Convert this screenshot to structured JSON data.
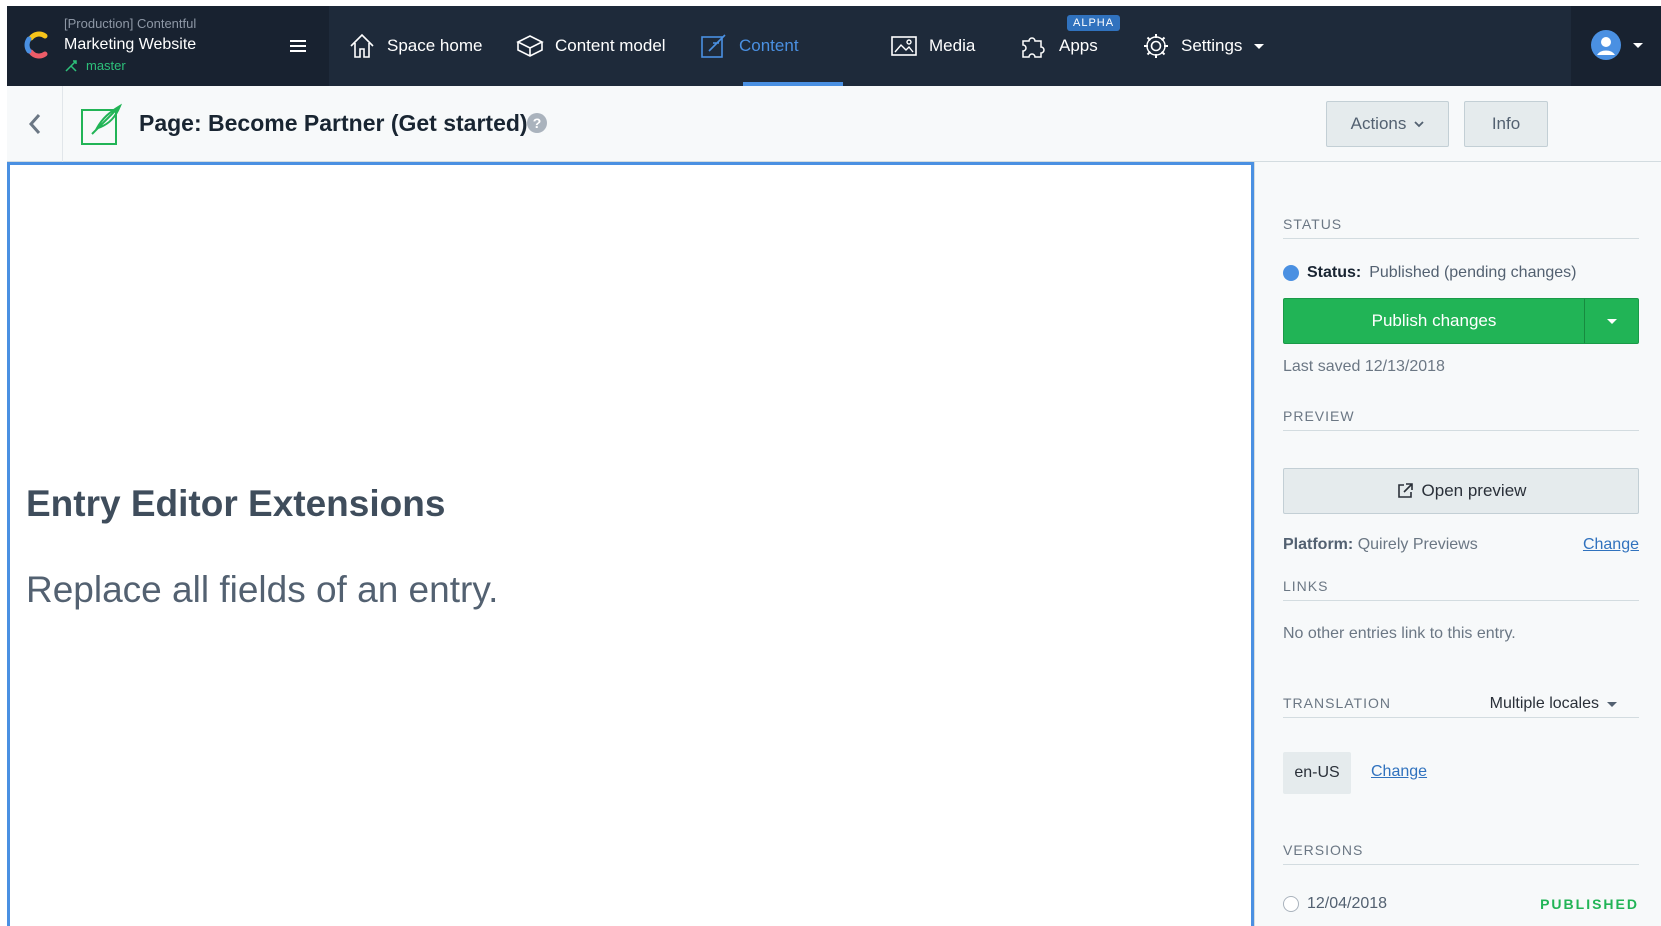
{
  "topnav": {
    "environment": "[Production] Contentful",
    "space_name": "Marketing Website",
    "branch": "master",
    "items": [
      {
        "label": "Space home",
        "icon": "home-icon"
      },
      {
        "label": "Content model",
        "icon": "content-model-icon"
      },
      {
        "label": "Content",
        "icon": "content-icon",
        "active": true
      },
      {
        "label": "Media",
        "icon": "media-icon"
      },
      {
        "label": "Apps",
        "icon": "puzzle-icon",
        "badge": "ALPHA"
      },
      {
        "label": "Settings",
        "icon": "gear-icon"
      }
    ]
  },
  "header": {
    "title": "Page: Become Partner (Get started)",
    "help": "?",
    "actions_label": "Actions",
    "info_label": "Info"
  },
  "main": {
    "title": "Entry Editor Extensions",
    "subtitle": "Replace all fields of an entry."
  },
  "sidebar": {
    "status_heading": "STATUS",
    "status_label": "Status:",
    "status_value": "Published (pending changes)",
    "publish_label": "Publish changes",
    "last_saved": "Last saved 12/13/2018",
    "preview_heading": "PREVIEW",
    "open_preview_label": "Open preview",
    "platform_label": "Platform:",
    "platform_value": "Quirely Previews",
    "change_label": "Change",
    "links_heading": "LINKS",
    "links_text": "No other entries link to this entry.",
    "translation_heading": "TRANSLATION",
    "locales_label": "Multiple locales",
    "locale": "en-US",
    "locale_change_label": "Change",
    "versions_heading": "VERSIONS",
    "version_date": "12/04/2018",
    "version_status": "PUBLISHED"
  },
  "colors": {
    "nav_bg": "#1e2a3a",
    "accent": "#4a90e2",
    "publish": "#21b456"
  }
}
